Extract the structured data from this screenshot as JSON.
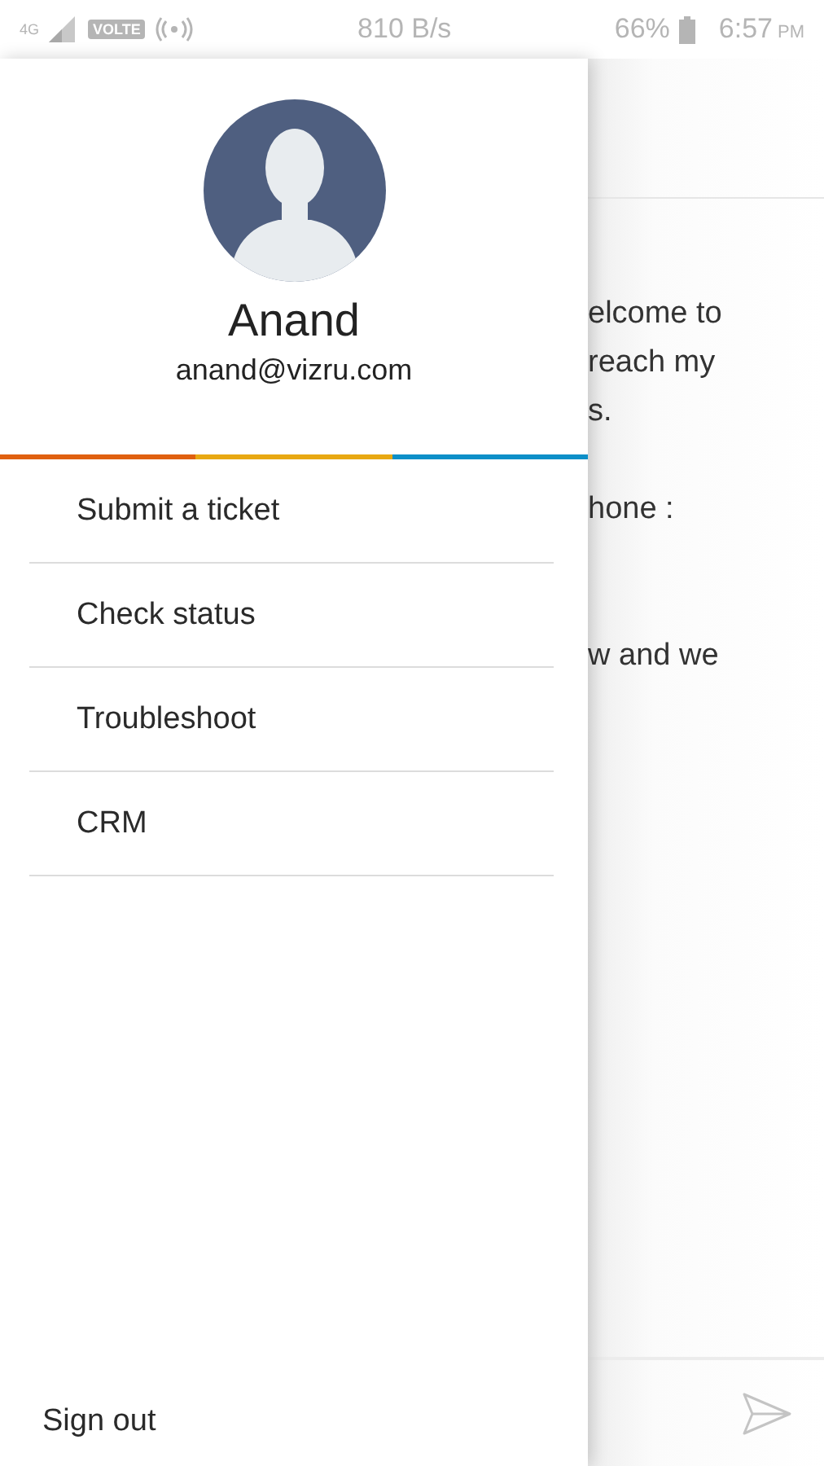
{
  "status_bar": {
    "network": "4G",
    "volte": "VOLTE",
    "speed": "810 B/s",
    "battery": "66%",
    "time": "6:57",
    "ampm": "PM"
  },
  "drawer": {
    "name": "Anand",
    "email": "anand@vizru.com",
    "items": [
      {
        "label": "Submit a ticket"
      },
      {
        "label": "Check status"
      },
      {
        "label": "Troubleshoot"
      },
      {
        "label": "CRM"
      }
    ],
    "sign_out": "Sign out"
  },
  "background_chat": {
    "paragraphs": [
      [
        "elcome to",
        "reach my",
        "s."
      ],
      [
        "hone :"
      ],
      [
        "w and we"
      ]
    ]
  }
}
